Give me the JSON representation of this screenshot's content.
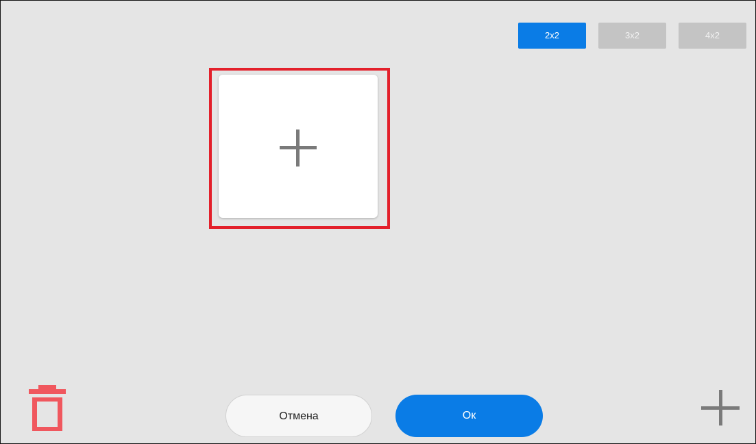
{
  "layout_tabs": [
    {
      "label": "2x2",
      "active": true
    },
    {
      "label": "3x2",
      "active": false
    },
    {
      "label": "4x2",
      "active": false
    }
  ],
  "tile": {
    "icon": "plus-icon"
  },
  "footer": {
    "delete_icon": "trash-icon",
    "cancel_label": "Отмена",
    "ok_label": "Ок",
    "add_icon": "plus-icon"
  },
  "colors": {
    "accent": "#0a7ce6",
    "inactive_tab": "#c4c4c4",
    "selection": "#e3202b",
    "delete": "#f0575e",
    "background": "#e5e5e5"
  }
}
